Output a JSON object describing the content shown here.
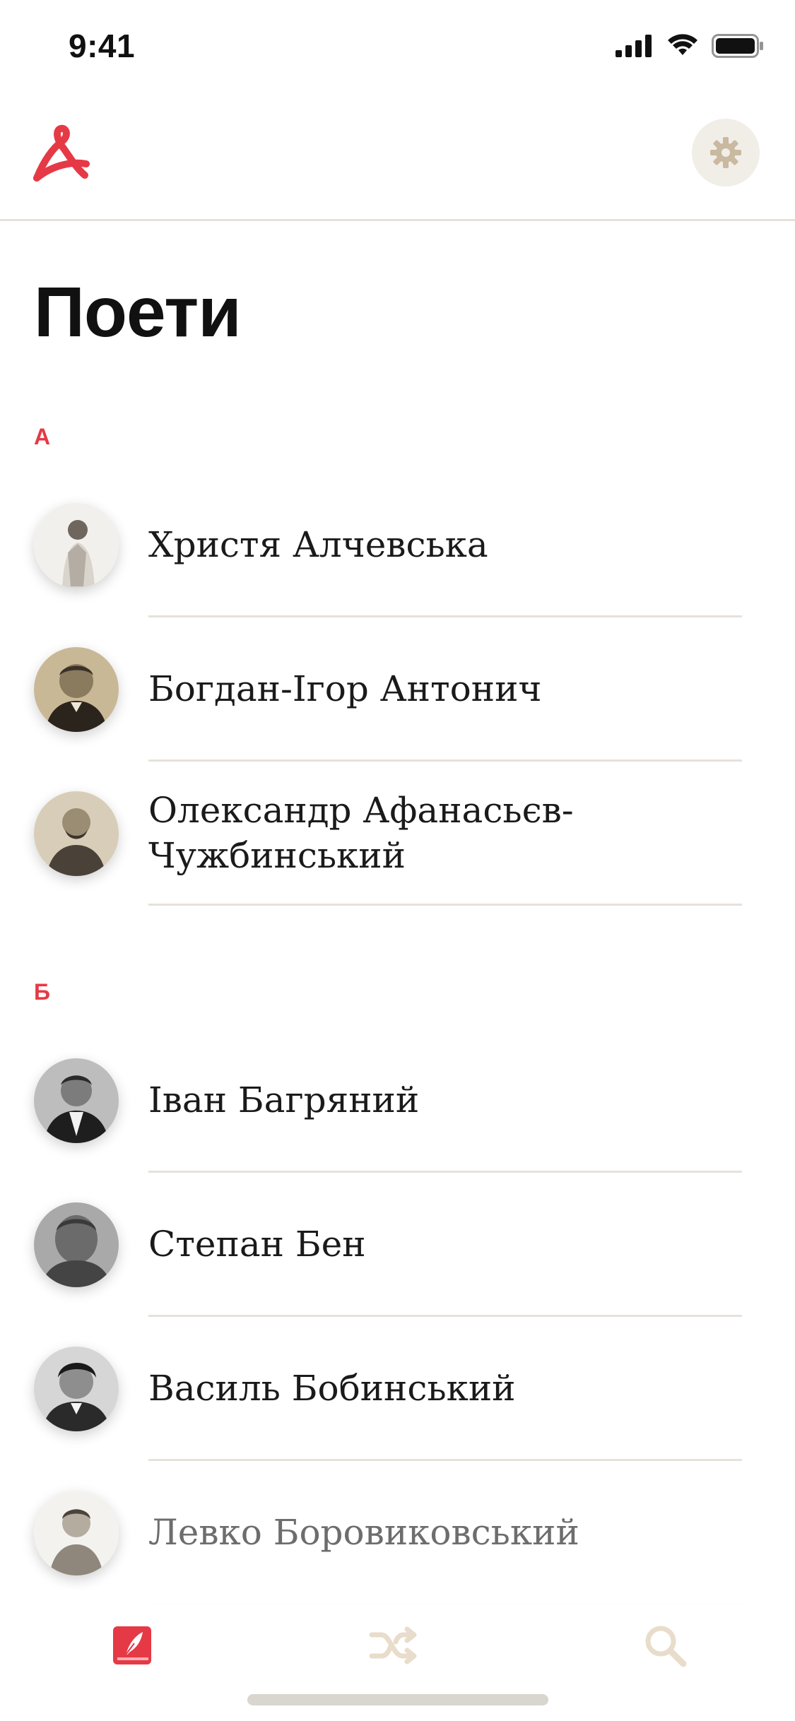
{
  "status_bar": {
    "time": "9:41"
  },
  "header": {
    "logo": "app-logo",
    "settings_icon": "gear-icon"
  },
  "page": {
    "title": "Поети"
  },
  "sections": [
    {
      "letter": "А",
      "poets": [
        {
          "name": "Христя Алчевська"
        },
        {
          "name": "Богдан-Ігор Антонич"
        },
        {
          "name": "Олександр Афанасьєв-Чужбинський"
        }
      ]
    },
    {
      "letter": "Б",
      "poets": [
        {
          "name": "Іван Багряний"
        },
        {
          "name": "Степан Бен"
        },
        {
          "name": "Василь Бобинський"
        },
        {
          "name": "Левко Боровиковський"
        }
      ]
    }
  ],
  "tab_bar": {
    "tabs": [
      {
        "name": "poets",
        "icon": "book-feather-icon",
        "active": true
      },
      {
        "name": "random",
        "icon": "shuffle-icon",
        "active": false
      },
      {
        "name": "search",
        "icon": "search-icon",
        "active": false
      }
    ]
  },
  "colors": {
    "accent": "#e63946",
    "divider": "#e6e2da",
    "inactive_icon": "#e8dccb"
  }
}
